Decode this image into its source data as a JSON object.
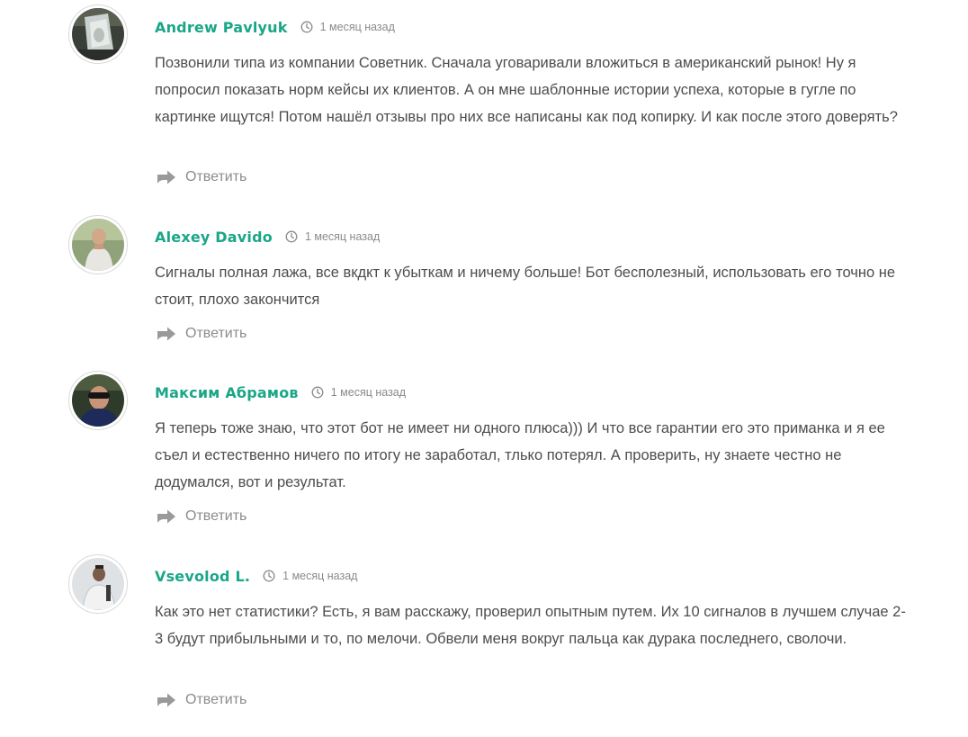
{
  "comments": [
    {
      "author": "Andrew Pavlyuk",
      "time": "1 месяц назад",
      "text": "Позвонили типа из компании Советник. Сначала уговаривали вложиться в американский рынок! Ну я попросил показать норм кейсы их клиентов. А он мне шаблонные истории успеха, которые в гугле по картинке ищутся! Потом нашёл отзывы про них все написаны как под копирку. И как после этого доверять?",
      "reply_label": "Ответить"
    },
    {
      "author": "Alexey Davido",
      "time": "1 месяц назад",
      "text": "Сигналы полная лажа, все вкдкт к убыткам и ничему больше! Бот бесполезный, использовать его точно не стоит, плохо закончится",
      "reply_label": "Ответить"
    },
    {
      "author": "Максим Абрамов",
      "time": "1 месяц назад",
      "text": "Я теперь тоже знаю, что этот бот не имеет ни одного плюса))) И что все гарантии его это приманка и я ее съел и естественно ничего по итогу не заработал, тлько потерял. А проверить, ну знаете честно не додумался, вот и результат.",
      "reply_label": "Ответить"
    },
    {
      "author": "Vsevolod L.",
      "time": "1 месяц назад",
      "text": "Как это нет статистики? Есть, я вам расскажу, проверил опытным путем. Их 10 сигналов в лучшем случае 2-3 будут прибыльными и то, по мелочи. Обвели меня вокруг пальца как дурака последнего, сволочи.",
      "reply_label": "Ответить"
    }
  ],
  "colors": {
    "author": "#1aa687",
    "text": "#4d4d4d",
    "muted": "#8a8a8a"
  },
  "icons": {
    "time": "clock-icon",
    "reply": "reply-arrow-icon"
  }
}
